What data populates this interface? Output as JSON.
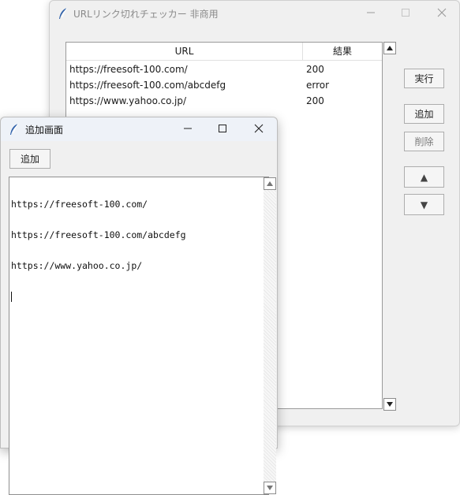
{
  "main_window": {
    "title": "URLリンク切れチェッカー 非商用",
    "table": {
      "columns": [
        "URL",
        "結果"
      ],
      "rows": [
        {
          "url": "https://freesoft-100.com/",
          "result": "200"
        },
        {
          "url": "https://freesoft-100.com/abcdefg",
          "result": "error"
        },
        {
          "url": "https://www.yahoo.co.jp/",
          "result": "200"
        }
      ]
    },
    "buttons": {
      "run": "実行",
      "add": "追加",
      "delete": "削除",
      "up": "▲",
      "down": "▼"
    }
  },
  "add_window": {
    "title": "追加画面",
    "add_button": "追加",
    "text_lines": [
      "https://freesoft-100.com/",
      "https://freesoft-100.com/abcdefg",
      "https://www.yahoo.co.jp/"
    ]
  },
  "icons": {
    "app": "feather-icon",
    "minimize": "minimize-icon",
    "maximize": "maximize-icon",
    "close": "close-icon"
  }
}
